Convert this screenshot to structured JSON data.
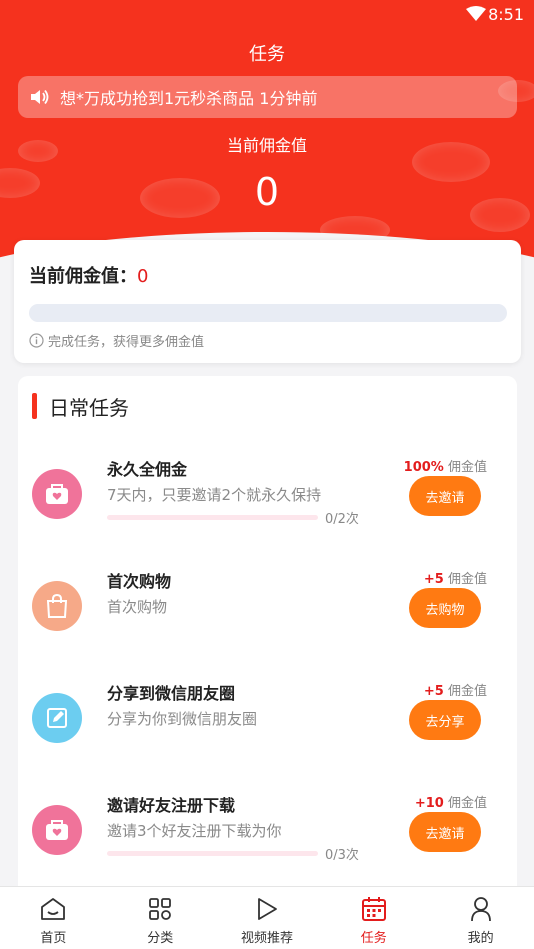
{
  "status_bar": {
    "time": "8:51"
  },
  "header": {
    "title": "任务",
    "notice": "想*万成功抢到1元秒杀商品 1分钟前",
    "commission_label": "当前佣金值",
    "commission_value": "0"
  },
  "progress_card": {
    "label": "当前佣金值：",
    "value": "0",
    "progress": 0,
    "hint": "完成任务，获得更多佣金值"
  },
  "daily_tasks": {
    "title": "日常任务",
    "items": [
      {
        "name": "永久全佣金",
        "desc": "7天内，只要邀请2个就永久保持",
        "reward_value": "100%",
        "reward_unit": "佣金值",
        "button": "去邀请",
        "progress_text": "0/2次",
        "progress": 0,
        "icon": "heart-bag-icon",
        "icon_color": "#f0739a"
      },
      {
        "name": "首次购物",
        "desc": "首次购物",
        "reward_value": "+5",
        "reward_unit": "佣金值",
        "button": "去购物",
        "icon": "shopping-bag-icon",
        "icon_color": "#f6a988"
      },
      {
        "name": "分享到微信朋友圈",
        "desc": "分享为你到微信朋友圈",
        "reward_value": "+5",
        "reward_unit": "佣金值",
        "button": "去分享",
        "icon": "share-edit-icon",
        "icon_color": "#6ccdf0"
      },
      {
        "name": "邀请好友注册下载",
        "desc": "邀请3个好友注册下载为你",
        "reward_value": "+10",
        "reward_unit": "佣金值",
        "button": "去邀请",
        "progress_text": "0/3次",
        "progress": 0,
        "icon": "heart-bag-icon",
        "icon_color": "#f0739a"
      }
    ]
  },
  "tabbar": {
    "items": [
      {
        "label": "首页",
        "icon": "home-icon"
      },
      {
        "label": "分类",
        "icon": "category-icon"
      },
      {
        "label": "视频推荐",
        "icon": "play-icon"
      },
      {
        "label": "任务",
        "icon": "calendar-icon",
        "active": true
      },
      {
        "label": "我的",
        "icon": "user-icon"
      }
    ]
  },
  "colors": {
    "primary": "#f5321e",
    "button": "#ff7a12",
    "accent_text": "#e31d1d"
  }
}
